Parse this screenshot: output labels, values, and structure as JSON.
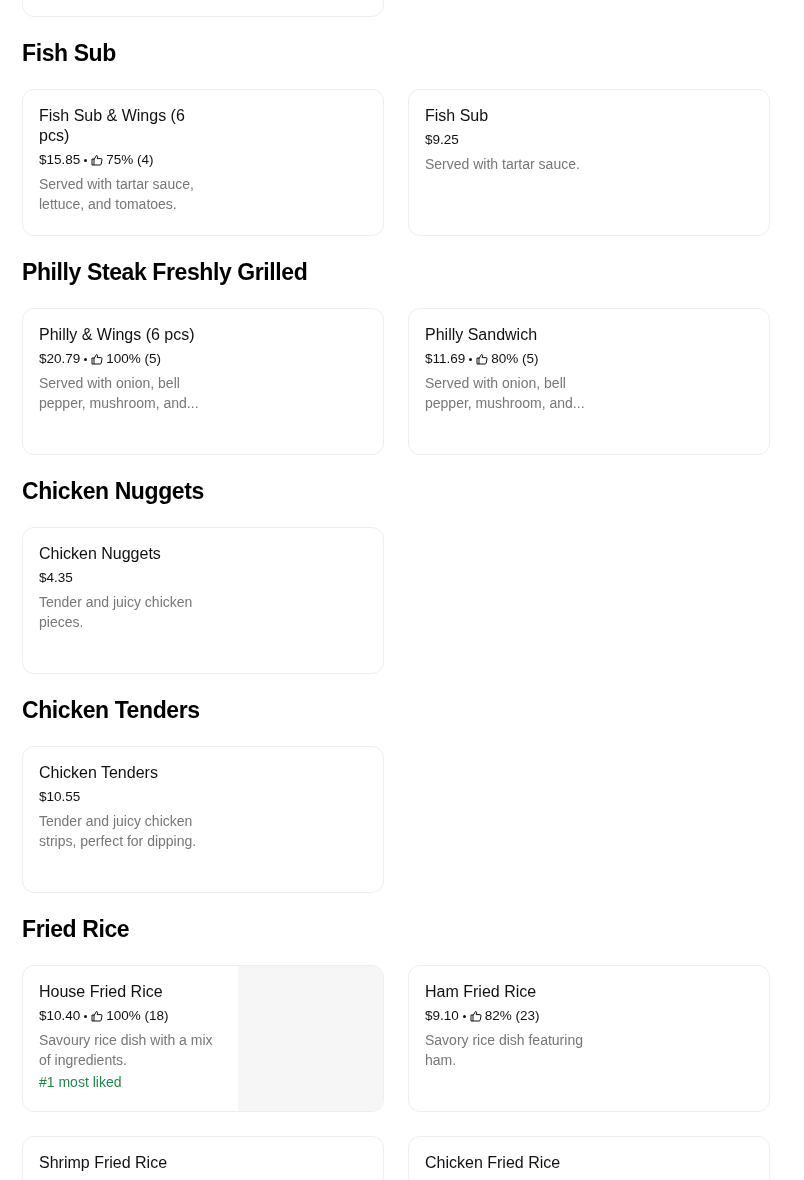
{
  "cut_card_above": true,
  "sections": [
    {
      "title": "Fish Sub",
      "items": [
        {
          "name": "Fish Sub & Wings (6 pcs)",
          "price": "$15.85",
          "rating": "75% (4)",
          "description": "Served with tartar sauce, lettuce, and tomatoes."
        },
        {
          "name": "Fish Sub",
          "price": "$9.25",
          "description": "Served with tartar sauce."
        }
      ]
    },
    {
      "title": "Philly Steak Freshly Grilled",
      "items": [
        {
          "name": "Philly & Wings (6 pcs)",
          "price": "$20.79",
          "rating": "100% (5)",
          "description": "Served with onion, bell pepper, mushroom, and..."
        },
        {
          "name": "Philly Sandwich",
          "price": "$11.69",
          "rating": "80% (5)",
          "description": "Served with onion, bell pepper, mushroom, and..."
        }
      ]
    },
    {
      "title": "Chicken Nuggets",
      "items": [
        {
          "name": "Chicken Nuggets",
          "price": "$4.35",
          "description": "Tender and juicy chicken pieces."
        }
      ]
    },
    {
      "title": "Chicken Tenders",
      "items": [
        {
          "name": "Chicken Tenders",
          "price": "$10.55",
          "description": "Tender and juicy chicken strips, perfect for dipping."
        }
      ]
    },
    {
      "title": "Fried Rice",
      "items": [
        {
          "name": "House Fried Rice",
          "price": "$10.40",
          "rating": "100% (18)",
          "description": "Savoury rice dish with a mix of ingredients.",
          "badge": "#1 most liked",
          "image_placeholder": true
        },
        {
          "name": "Ham Fried Rice",
          "price": "$9.10",
          "rating": "82% (23)",
          "description": "Savory rice dish featuring ham."
        },
        {
          "name": "Shrimp Fried Rice"
        },
        {
          "name": "Chicken Fried Rice"
        }
      ]
    }
  ]
}
